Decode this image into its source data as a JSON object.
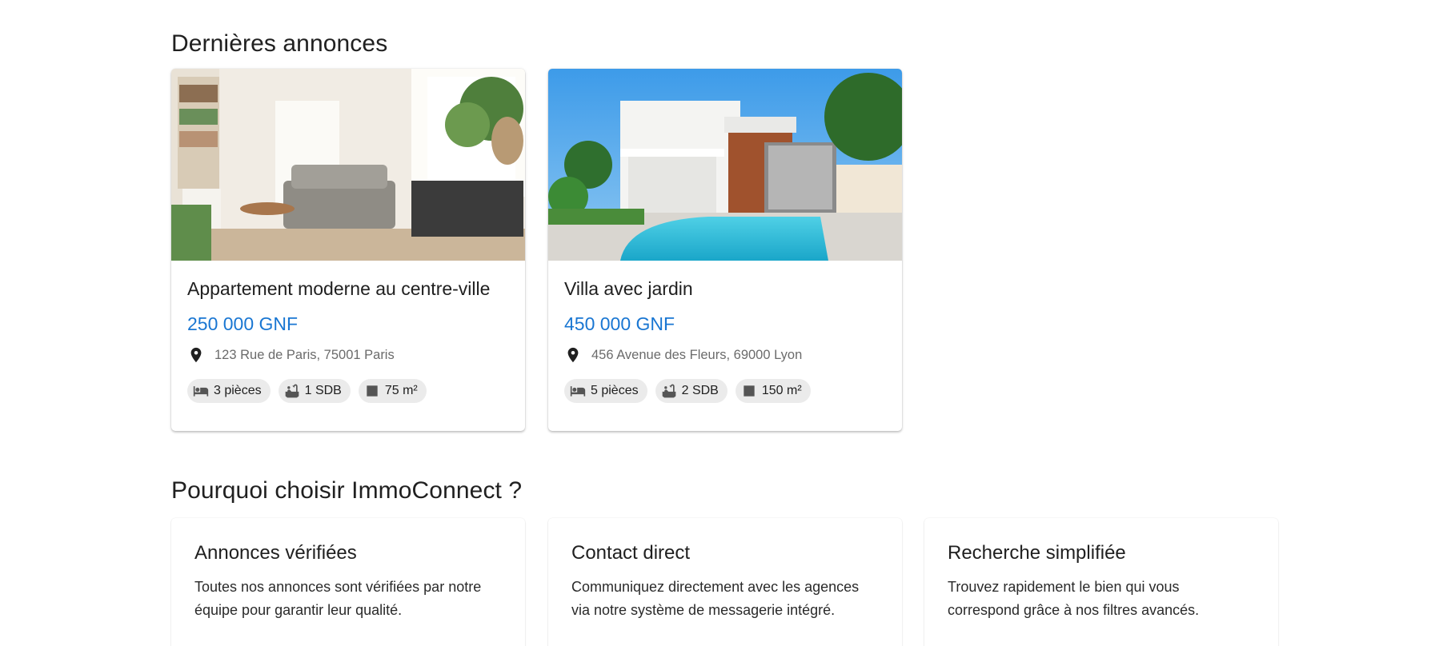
{
  "sections": {
    "latest_title": "Dernières annonces",
    "why_title": "Pourquoi choisir ImmoConnect ?"
  },
  "listings": [
    {
      "title": "Appartement moderne au centre-ville",
      "price": "250 000 GNF",
      "address": "123 Rue de Paris, 75001 Paris",
      "rooms": "3 pièces",
      "baths": "1 SDB",
      "area": "75 m²",
      "image": "living-room-photo"
    },
    {
      "title": "Villa avec jardin",
      "price": "450 000 GNF",
      "address": "456 Avenue des Fleurs, 69000 Lyon",
      "rooms": "5 pièces",
      "baths": "2 SDB",
      "area": "150 m²",
      "image": "villa-pool-photo"
    }
  ],
  "features": [
    {
      "title": "Annonces vérifiées",
      "text": "Toutes nos annonces sont vérifiées par notre équipe pour garantir leur qualité."
    },
    {
      "title": "Contact direct",
      "text": "Communiquez directement avec les agences via notre système de messagerie intégré."
    },
    {
      "title": "Recherche simplifiée",
      "text": "Trouvez rapidement le bien qui vous correspond grâce à nos filtres avancés."
    }
  ],
  "colors": {
    "accent": "#1976d2",
    "chip_bg": "#ebebeb"
  },
  "icons": {
    "location": "location-pin-icon",
    "rooms": "bed-icon",
    "baths": "bathtub-icon",
    "area": "square-area-icon"
  }
}
